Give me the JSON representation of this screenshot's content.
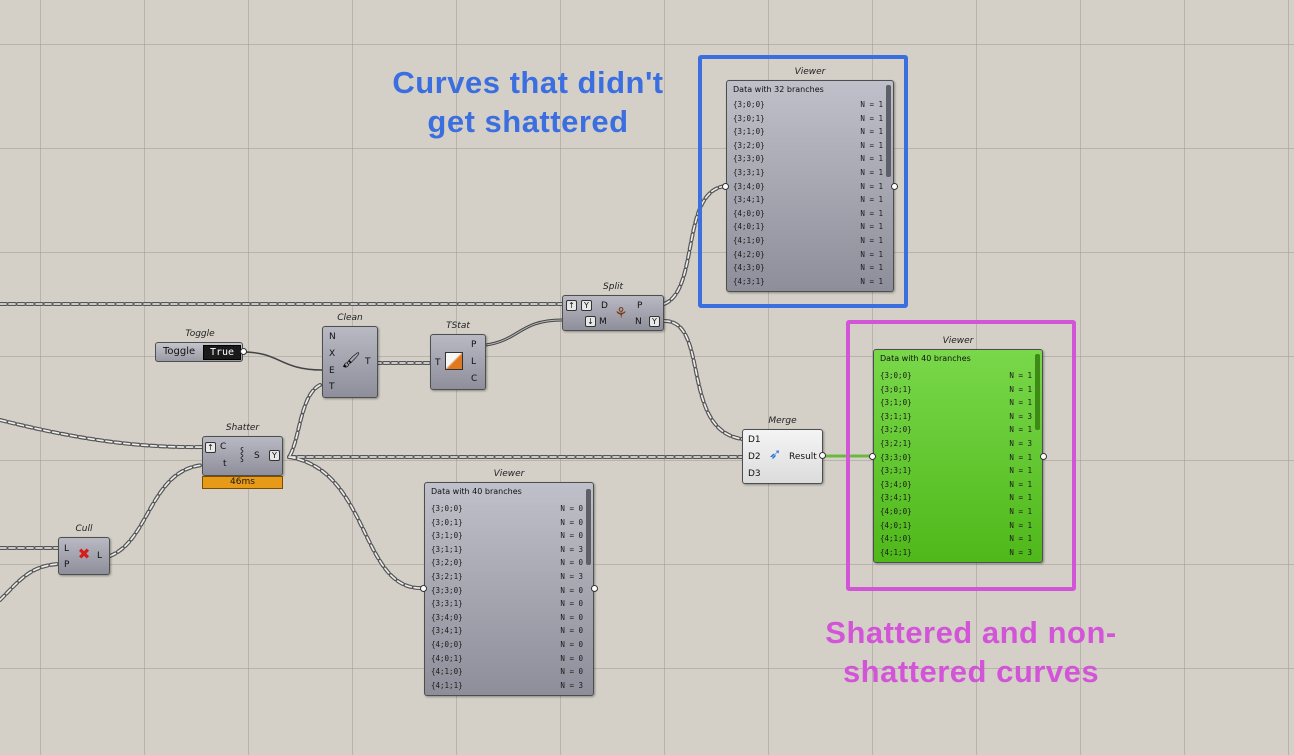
{
  "annotations": {
    "top": [
      "Curves that didn't",
      "get shattered"
    ],
    "bottom": [
      "Shattered and non-",
      "shattered curves"
    ],
    "top_color": "#3b6fe0",
    "bottom_color": "#d255d8"
  },
  "components": {
    "toggle": {
      "title": "Toggle",
      "label": "Toggle",
      "value": "True"
    },
    "clean": {
      "title": "Clean",
      "inputs": [
        "N",
        "X",
        "E",
        "T"
      ],
      "output": "T"
    },
    "tstat": {
      "title": "TStat",
      "input": "T",
      "outputs": [
        "P",
        "L",
        "C"
      ]
    },
    "split": {
      "title": "Split",
      "inputs": [
        "D",
        "M"
      ],
      "outputs": [
        "P",
        "N"
      ]
    },
    "shatter": {
      "title": "Shatter",
      "inputs": [
        "C",
        "t"
      ],
      "output": "S",
      "timer": "46ms"
    },
    "cull": {
      "title": "Cull",
      "inputs": [
        "L",
        "P"
      ],
      "output": "L"
    },
    "merge": {
      "title": "Merge",
      "inputs": [
        "D1",
        "D2",
        "D3"
      ],
      "output": "Result"
    }
  },
  "viewers": {
    "top": {
      "title": "Viewer",
      "header": "Data with 32 branches",
      "rows": [
        {
          "path": "{3;0;0}",
          "n": "N = 1"
        },
        {
          "path": "{3;0;1}",
          "n": "N = 1"
        },
        {
          "path": "{3;1;0}",
          "n": "N = 1"
        },
        {
          "path": "{3;2;0}",
          "n": "N = 1"
        },
        {
          "path": "{3;3;0}",
          "n": "N = 1"
        },
        {
          "path": "{3;3;1}",
          "n": "N = 1"
        },
        {
          "path": "{3;4;0}",
          "n": "N = 1"
        },
        {
          "path": "{3;4;1}",
          "n": "N = 1"
        },
        {
          "path": "{4;0;0}",
          "n": "N = 1"
        },
        {
          "path": "{4;0;1}",
          "n": "N = 1"
        },
        {
          "path": "{4;1;0}",
          "n": "N = 1"
        },
        {
          "path": "{4;2;0}",
          "n": "N = 1"
        },
        {
          "path": "{4;3;0}",
          "n": "N = 1"
        },
        {
          "path": "{4;3;1}",
          "n": "N = 1"
        }
      ]
    },
    "right": {
      "title": "Viewer",
      "header": "Data with 40 branches",
      "rows": [
        {
          "path": "{3;0;0}",
          "n": "N = 1"
        },
        {
          "path": "{3;0;1}",
          "n": "N = 1"
        },
        {
          "path": "{3;1;0}",
          "n": "N = 1"
        },
        {
          "path": "{3;1;1}",
          "n": "N = 3"
        },
        {
          "path": "{3;2;0}",
          "n": "N = 1"
        },
        {
          "path": "{3;2;1}",
          "n": "N = 3"
        },
        {
          "path": "{3;3;0}",
          "n": "N = 1"
        },
        {
          "path": "{3;3;1}",
          "n": "N = 1"
        },
        {
          "path": "{3;4;0}",
          "n": "N = 1"
        },
        {
          "path": "{3;4;1}",
          "n": "N = 1"
        },
        {
          "path": "{4;0;0}",
          "n": "N = 1"
        },
        {
          "path": "{4;0;1}",
          "n": "N = 1"
        },
        {
          "path": "{4;1;0}",
          "n": "N = 1"
        },
        {
          "path": "{4;1;1}",
          "n": "N = 3"
        }
      ]
    },
    "bottom": {
      "title": "Viewer",
      "header": "Data with 40 branches",
      "rows": [
        {
          "path": "{3;0;0}",
          "n": "N = 0"
        },
        {
          "path": "{3;0;1}",
          "n": "N = 0"
        },
        {
          "path": "{3;1;0}",
          "n": "N = 0"
        },
        {
          "path": "{3;1;1}",
          "n": "N = 3"
        },
        {
          "path": "{3;2;0}",
          "n": "N = 0"
        },
        {
          "path": "{3;2;1}",
          "n": "N = 3"
        },
        {
          "path": "{3;3;0}",
          "n": "N = 0"
        },
        {
          "path": "{3;3;1}",
          "n": "N = 0"
        },
        {
          "path": "{3;4;0}",
          "n": "N = 0"
        },
        {
          "path": "{3;4;1}",
          "n": "N = 0"
        },
        {
          "path": "{4;0;0}",
          "n": "N = 0"
        },
        {
          "path": "{4;0;1}",
          "n": "N = 0"
        },
        {
          "path": "{4;1;0}",
          "n": "N = 0"
        },
        {
          "path": "{4;1;1}",
          "n": "N = 3"
        }
      ]
    }
  }
}
